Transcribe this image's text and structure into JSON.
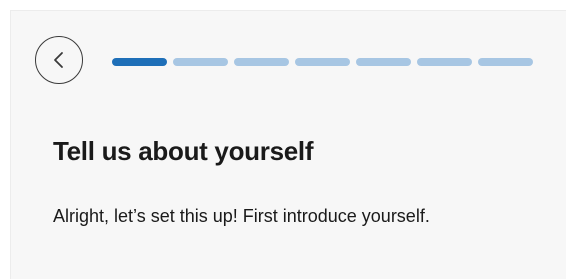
{
  "header": {
    "back_icon": "chevron-left-icon",
    "progress": {
      "total_steps": 7,
      "current_step": 1,
      "active_color": "#1e6fb8",
      "inactive_color": "#a7c6e3"
    }
  },
  "content": {
    "title": "Tell us about yourself",
    "subtitle": "Alright, let’s set this up! First introduce yourself."
  }
}
